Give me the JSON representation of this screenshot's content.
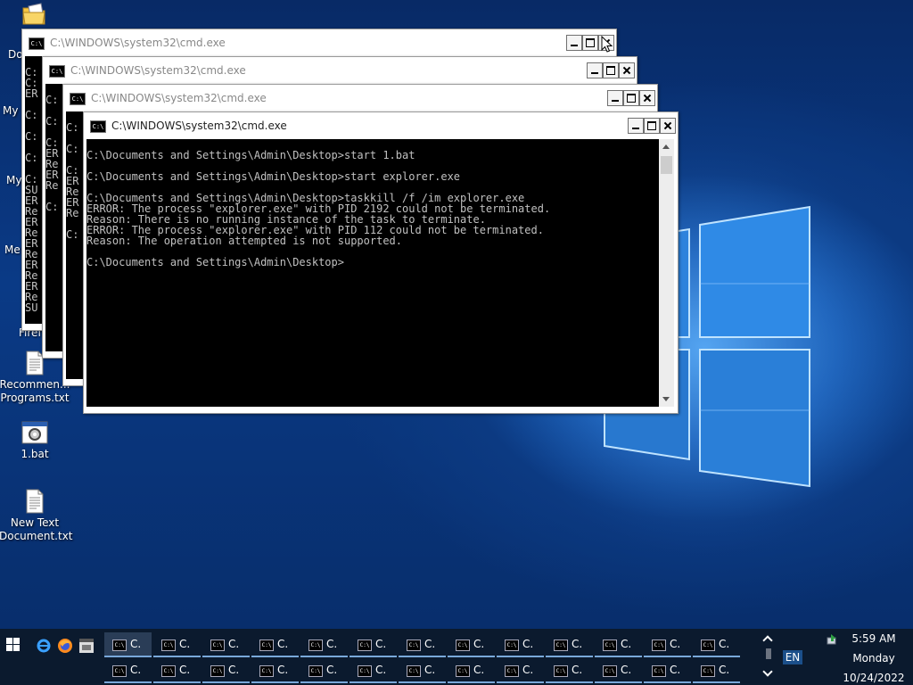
{
  "desktop": {
    "icons": [
      {
        "label": "Recommen... Programs.txt"
      },
      {
        "label": "1.bat"
      },
      {
        "label": "New Text Document.txt"
      }
    ],
    "partial_labels": [
      "Do",
      "My",
      "My",
      "Me",
      "Firef"
    ]
  },
  "windows": [
    {
      "title": "C:\\WINDOWS\\system32\\cmd.exe",
      "lines": [
        "",
        "C:",
        "C:",
        "ER",
        "",
        "C:",
        "",
        "C:",
        "",
        "C:",
        "",
        "C:",
        "SU",
        "ER",
        "Re",
        "ER",
        "Re",
        "ER",
        "Re",
        "ER",
        "Re",
        "ER",
        "Re",
        "SU",
        "",
        "C:"
      ]
    },
    {
      "title": "C:\\WINDOWS\\system32\\cmd.exe",
      "lines": [
        "",
        "C:",
        "",
        "C:",
        "",
        "C:",
        "ER",
        "Re",
        "ER",
        "Re",
        "",
        "C:"
      ]
    },
    {
      "title": "C:\\WINDOWS\\system32\\cmd.exe",
      "lines": [
        "",
        "C:",
        "",
        "C:",
        "",
        "C:",
        "ER",
        "Re",
        "ER",
        "Re",
        "",
        "C:"
      ]
    },
    {
      "title": "C:\\WINDOWS\\system32\\cmd.exe",
      "lines": [
        "",
        "C:\\Documents and Settings\\Admin\\Desktop>start 1.bat",
        "",
        "C:\\Documents and Settings\\Admin\\Desktop>start explorer.exe",
        "",
        "C:\\Documents and Settings\\Admin\\Desktop>taskkill /f /im explorer.exe",
        "ERROR: The process \"explorer.exe\" with PID 2192 could not be terminated.",
        "Reason: There is no running instance of the task to terminate.",
        "ERROR: The process \"explorer.exe\" with PID 112 could not be terminated.",
        "Reason: The operation attempted is not supported.",
        "",
        "C:\\Documents and Settings\\Admin\\Desktop>"
      ]
    }
  ],
  "console_icon_text": "C:\\",
  "taskbar": {
    "button_label": "C.",
    "button_count_per_row": 13,
    "tray": {
      "language": "EN",
      "time": "5:59 AM",
      "day": "Monday",
      "date": "10/24/2022"
    }
  },
  "colors": {
    "console_bg": "#000000",
    "console_text": "#c0c0c0",
    "taskbar_bg": "#0b1a2e",
    "taskbar_accent": "#79a8da"
  }
}
